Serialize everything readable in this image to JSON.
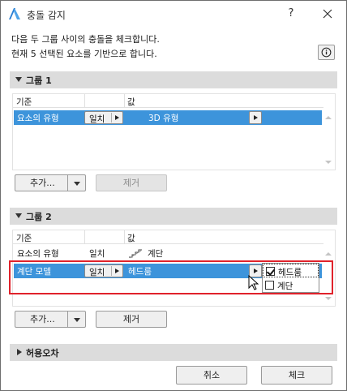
{
  "window": {
    "title": "충돌 감지",
    "help_label": "?"
  },
  "description": {
    "line1": "다음 두 그룹 사이의 충돌을 체크합니다.",
    "line2": "현재 5 선택된 요소를 기반으로 합니다."
  },
  "group1": {
    "title": "그룹 1",
    "columns": {
      "criteria": "기준",
      "value": "값"
    },
    "rows": [
      {
        "criterion": "요소의 유형",
        "match": "일치",
        "value": "3D 유형",
        "selected": true
      }
    ],
    "add_label": "추가...",
    "remove_label": "제거"
  },
  "group2": {
    "title": "그룹 2",
    "columns": {
      "criteria": "기준",
      "value": "값"
    },
    "rows": [
      {
        "criterion": "요소의 유형",
        "match": "일치",
        "value": "계단",
        "selected": false
      },
      {
        "criterion": "계단 모델",
        "match": "일치",
        "value": "헤드룸",
        "selected": true
      }
    ],
    "add_label": "추가...",
    "remove_label": "제거"
  },
  "value_popup": {
    "items": [
      {
        "label": "헤드룸",
        "checked": true
      },
      {
        "label": "계단",
        "checked": false
      }
    ]
  },
  "tolerance": {
    "title": "허용오차"
  },
  "footer": {
    "cancel_label": "취소",
    "check_label": "체크"
  },
  "colors": {
    "selection": "#3d94db",
    "highlight_border": "#e0222b",
    "app_icon": "#2a7fd4"
  }
}
